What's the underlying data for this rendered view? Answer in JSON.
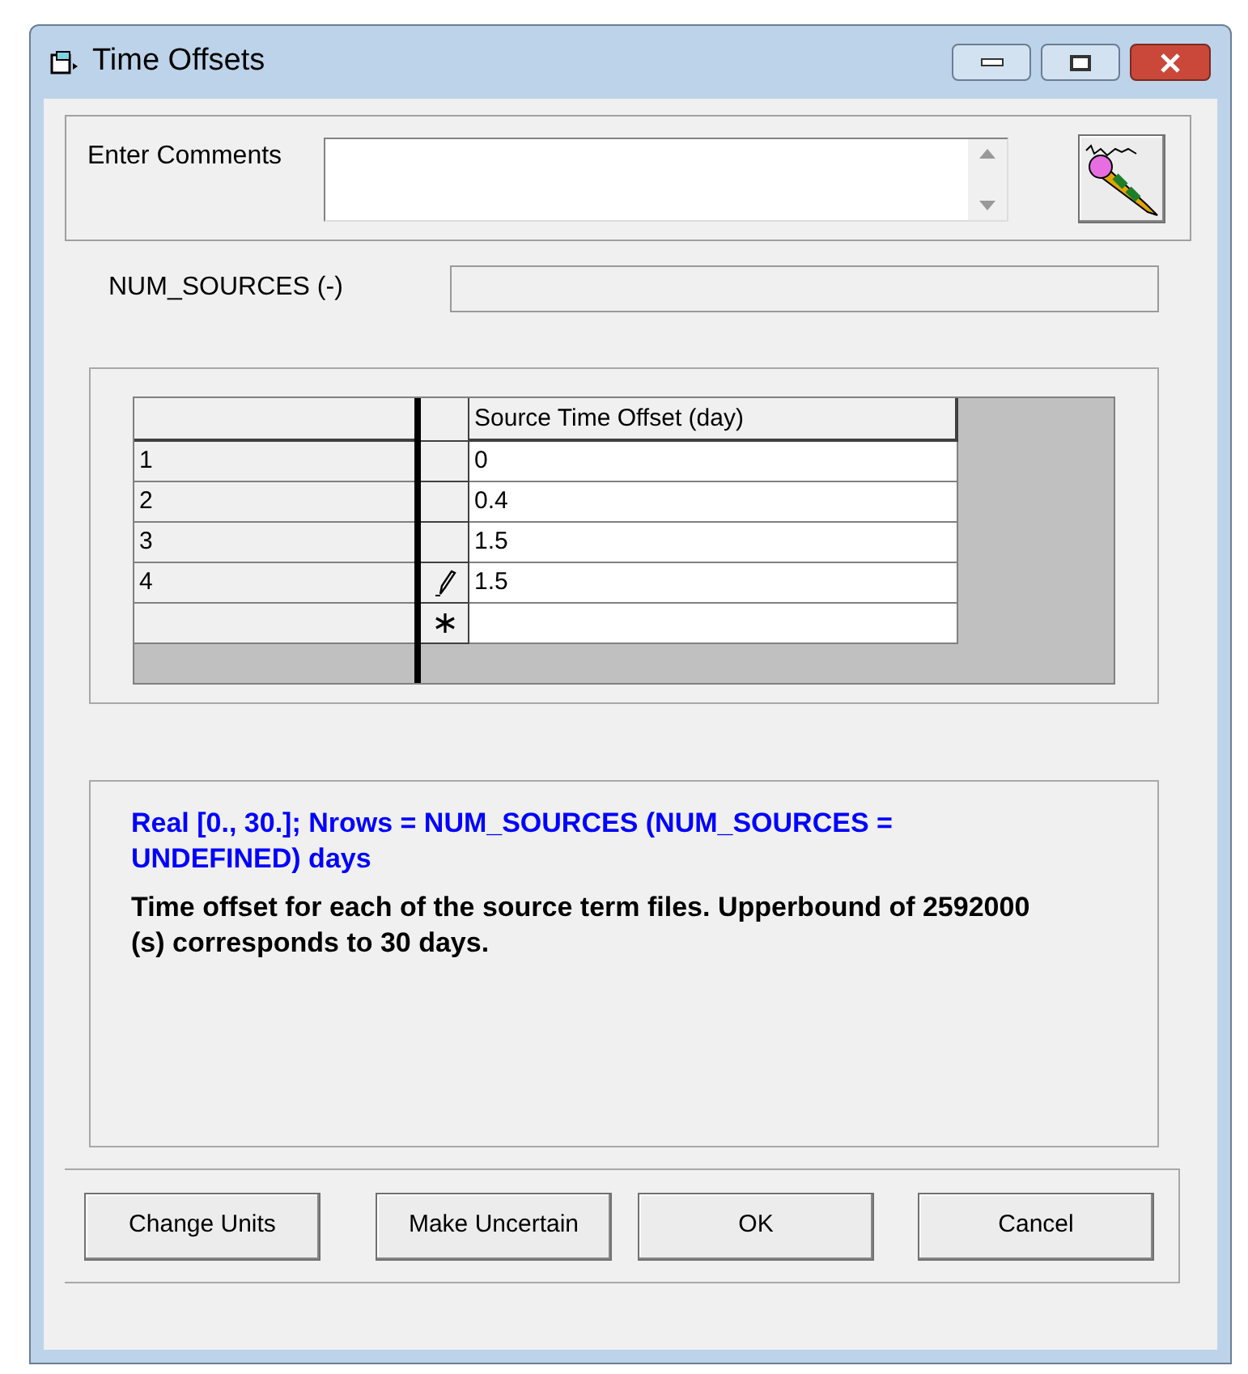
{
  "window": {
    "title": "Time Offsets"
  },
  "comments": {
    "label": "Enter Comments"
  },
  "num_sources": {
    "label": "NUM_SOURCES (-)"
  },
  "table": {
    "columns": [
      "Source Time Offset (day)"
    ],
    "rows": [
      {
        "kind": "plain",
        "number": "1",
        "value": "0"
      },
      {
        "kind": "plain",
        "number": "2",
        "value": "0.4"
      },
      {
        "kind": "plain",
        "number": "3",
        "value": "1.5"
      },
      {
        "kind": "editing",
        "number": "4",
        "value": "1.5"
      },
      {
        "kind": "new"
      }
    ]
  },
  "description": {
    "range": "Real [0., 30.];  Nrows = NUM_SOURCES (NUM_SOURCES = UNDEFINED)  days",
    "text": "Time offset for each of the source term files.  Upperbound of 2592000 (s) corresponds to 30 days."
  },
  "buttons": [
    "Change Units",
    "Make Uncertain",
    "OK",
    "Cancel"
  ]
}
